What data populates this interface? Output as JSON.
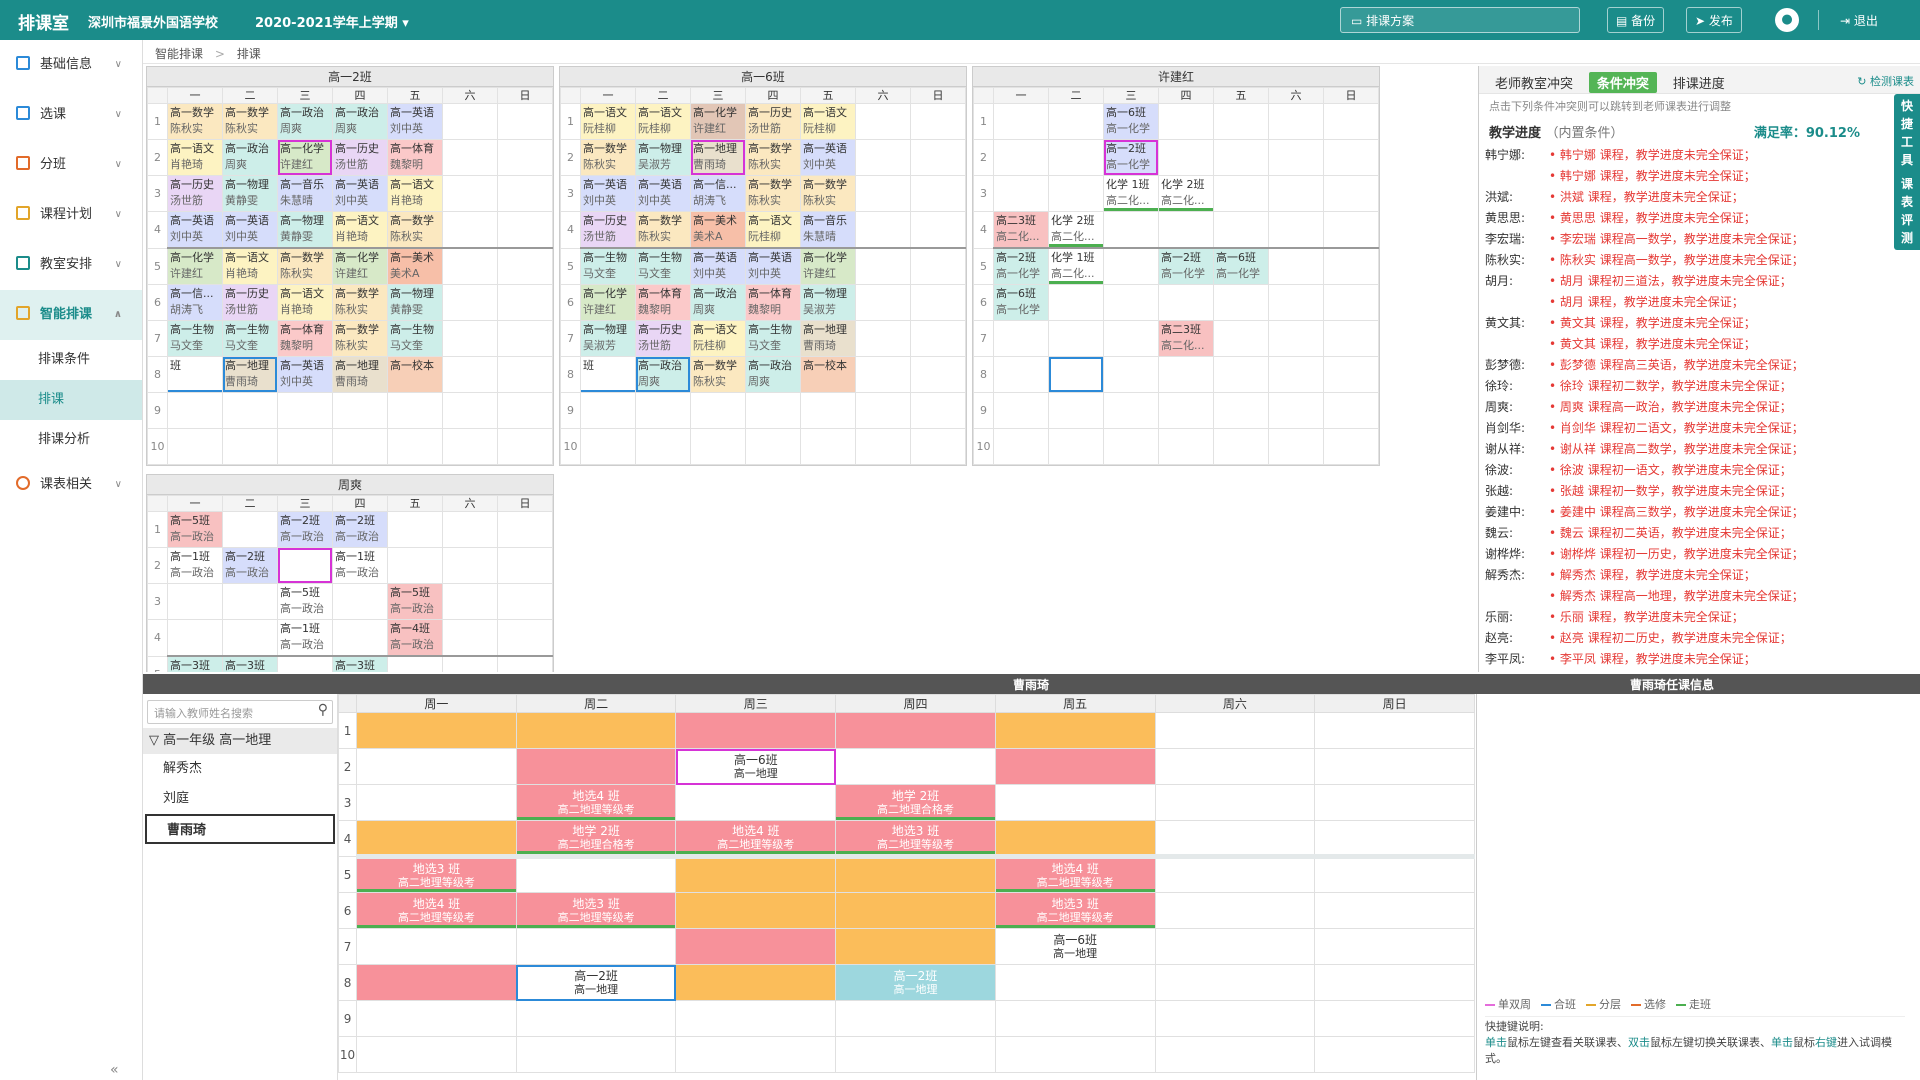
{
  "topbar": {
    "brand": "排课室",
    "school": "深圳市福景外国语学校",
    "term": "2020-2021学年上学期 ▾",
    "scheme": "排课方案",
    "backup": "备份",
    "publish": "发布",
    "logout": "退出"
  },
  "sidebar": {
    "items": [
      {
        "label": "基础信息",
        "icon": "info-icon",
        "color": "#2c8ad8"
      },
      {
        "label": "选课",
        "icon": "pencil-icon",
        "color": "#2c8ad8"
      },
      {
        "label": "分班",
        "icon": "branch-icon",
        "color": "#e26b2a"
      },
      {
        "label": "课程计划",
        "icon": "calendar-icon",
        "color": "#e2a52a"
      },
      {
        "label": "教室安排",
        "icon": "classroom-icon",
        "color": "#1b8c8a"
      },
      {
        "label": "智能排课",
        "icon": "smart-icon",
        "color": "#e2a52a"
      }
    ],
    "subitems": [
      "排课条件",
      "排课",
      "排课分析"
    ],
    "last": {
      "label": "课表相关",
      "icon": "search-icon",
      "color": "#e26b2a"
    }
  },
  "breadcrumb": {
    "root": "智能排课",
    "sep": ">",
    "current": "排课"
  },
  "weekdays_short": [
    "一",
    "二",
    "三",
    "四",
    "五",
    "六",
    "日"
  ],
  "weekdays_long": [
    "周一",
    "周二",
    "周三",
    "周四",
    "周五",
    "周六",
    "周日"
  ],
  "grids": [
    {
      "title": "高一2班",
      "rows": [
        [
          [
            "高一数学",
            "陈秋实",
            "#fbe8c0"
          ],
          [
            "高一数学",
            "陈秋实",
            "#fbe8c0"
          ],
          [
            "高一政治",
            "周爽",
            "#cdeee9"
          ],
          [
            "高一政治",
            "周爽",
            "#cdeee9"
          ],
          [
            "高一英语",
            "刘中英",
            "#d6ddfb"
          ],
          null,
          null
        ],
        [
          [
            "高一语文",
            "肖艳琦",
            "#fdf3c2"
          ],
          [
            "高一政治",
            "周爽",
            "#cdeee9"
          ],
          [
            "高一化学",
            "许建红",
            "#d7e9c8"
          ],
          [
            "高一历史",
            "汤世筋",
            "#e9d6f5"
          ],
          [
            "高一体育",
            "魏黎明",
            "#fbc9c9"
          ],
          null,
          null
        ],
        [
          [
            "高一历史",
            "汤世筋",
            "#e9d6f5"
          ],
          [
            "高一物理",
            "黄静雯",
            "#cdeee9"
          ],
          [
            "高一音乐",
            "朱慧晴",
            "#d6ddfb"
          ],
          [
            "高一英语",
            "刘中英",
            "#d6ddfb"
          ],
          [
            "高一语文",
            "肖艳琦",
            "#fdf3c2"
          ],
          null,
          null
        ],
        [
          [
            "高一英语",
            "刘中英",
            "#d6ddfb"
          ],
          [
            "高一英语",
            "刘中英",
            "#d6ddfb"
          ],
          [
            "高一物理",
            "黄静雯",
            "#cdeee9"
          ],
          [
            "高一语文",
            "肖艳琦",
            "#fdf3c2"
          ],
          [
            "高一数学",
            "陈秋实",
            "#fbe8c0"
          ],
          null,
          null
        ],
        [
          [
            "高一化学",
            "许建红",
            "#d7e9c8"
          ],
          [
            "高一语文",
            "肖艳琦",
            "#fdf3c2"
          ],
          [
            "高一数学",
            "陈秋实",
            "#fbe8c0"
          ],
          [
            "高一化学",
            "许建红",
            "#d7e9c8"
          ],
          [
            "高一美术",
            "美术A",
            "#f7bfa8"
          ],
          null,
          null
        ],
        [
          [
            "高一信...",
            "胡涛飞",
            "#d6ddfb"
          ],
          [
            "高一历史",
            "汤世筋",
            "#e9d6f5"
          ],
          [
            "高一语文",
            "肖艳琦",
            "#fdf3c2"
          ],
          [
            "高一数学",
            "陈秋实",
            "#fbe8c0"
          ],
          [
            "高一物理",
            "黄静雯",
            "#cdeee9"
          ],
          null,
          null
        ],
        [
          [
            "高一生物",
            "马文奎",
            "#cdeee9"
          ],
          [
            "高一生物",
            "马文奎",
            "#cdeee9"
          ],
          [
            "高一体育",
            "魏黎明",
            "#fbc9c9"
          ],
          [
            "高一数学",
            "陈秋实",
            "#fbe8c0"
          ],
          [
            "高一生物",
            "马文奎",
            "#cdeee9"
          ],
          null,
          null
        ],
        [
          [
            "班",
            "",
            "#ffffff"
          ],
          [
            "高一地理",
            "曹雨琦",
            "#e9e0cd"
          ],
          [
            "高一英语",
            "刘中英",
            "#d6ddfb"
          ],
          [
            "高一地理",
            "曹雨琦",
            "#e9e0cd"
          ],
          [
            "高一校本",
            "",
            "#f7cfb7"
          ],
          null,
          null
        ],
        [
          null,
          null,
          null,
          null,
          null,
          null,
          null
        ],
        [
          null,
          null,
          null,
          null,
          null,
          null,
          null
        ]
      ]
    },
    {
      "title": "高一6班",
      "rows": [
        [
          [
            "高一语文",
            "阮桂柳",
            "#fdf3c2"
          ],
          [
            "高一语文",
            "阮桂柳",
            "#fdf3c2"
          ],
          [
            "高一化学",
            "许建红",
            "#e2c6b6"
          ],
          [
            "高一历史",
            "汤世筋",
            "#fbe8c0"
          ],
          [
            "高一语文",
            "阮桂柳",
            "#fdf3c2"
          ],
          null,
          null
        ],
        [
          [
            "高一数学",
            "陈秋实",
            "#fbe8c0"
          ],
          [
            "高一物理",
            "吴淑芳",
            "#cdeee9"
          ],
          [
            "高一地理",
            "曹雨琦",
            "#e9e0cd"
          ],
          [
            "高一数学",
            "陈秋实",
            "#fbe8c0"
          ],
          [
            "高一英语",
            "刘中英",
            "#d6ddfb"
          ],
          null,
          null
        ],
        [
          [
            "高一英语",
            "刘中英",
            "#d6ddfb"
          ],
          [
            "高一英语",
            "刘中英",
            "#d6ddfb"
          ],
          [
            "高一信...",
            "胡涛飞",
            "#d6ddfb"
          ],
          [
            "高一数学",
            "陈秋实",
            "#fbe8c0"
          ],
          [
            "高一数学",
            "陈秋实",
            "#fbe8c0"
          ],
          null,
          null
        ],
        [
          [
            "高一历史",
            "汤世筋",
            "#e9d6f5"
          ],
          [
            "高一数学",
            "陈秋实",
            "#fbe8c0"
          ],
          [
            "高一美术",
            "美术A",
            "#f7bfa8"
          ],
          [
            "高一语文",
            "阮桂柳",
            "#fdf3c2"
          ],
          [
            "高一音乐",
            "朱慧晴",
            "#d6ddfb"
          ],
          null,
          null
        ],
        [
          [
            "高一生物",
            "马文奎",
            "#cdeee9"
          ],
          [
            "高一生物",
            "马文奎",
            "#cdeee9"
          ],
          [
            "高一英语",
            "刘中英",
            "#d6ddfb"
          ],
          [
            "高一英语",
            "刘中英",
            "#d6ddfb"
          ],
          [
            "高一化学",
            "许建红",
            "#d7e9c8"
          ],
          null,
          null
        ],
        [
          [
            "高一化学",
            "许建红",
            "#d7e9c8"
          ],
          [
            "高一体育",
            "魏黎明",
            "#fbc9c9"
          ],
          [
            "高一政治",
            "周爽",
            "#cdeee9"
          ],
          [
            "高一体育",
            "魏黎明",
            "#fbc9c9"
          ],
          [
            "高一物理",
            "吴淑芳",
            "#cdeee9"
          ],
          null,
          null
        ],
        [
          [
            "高一物理",
            "吴淑芳",
            "#cdeee9"
          ],
          [
            "高一历史",
            "汤世筋",
            "#e9d6f5"
          ],
          [
            "高一语文",
            "阮桂柳",
            "#fdf3c2"
          ],
          [
            "高一生物",
            "马文奎",
            "#cdeee9"
          ],
          [
            "高一地理",
            "曹雨琦",
            "#e9e0cd"
          ],
          null,
          null
        ],
        [
          [
            "班",
            "",
            "#ffffff"
          ],
          [
            "高一政治",
            "周爽",
            "#cdeee9"
          ],
          [
            "高一数学",
            "陈秋实",
            "#fbe8c0"
          ],
          [
            "高一政治",
            "周爽",
            "#cdeee9"
          ],
          [
            "高一校本",
            "",
            "#f7cfb7"
          ],
          null,
          null
        ],
        [
          null,
          null,
          null,
          null,
          null,
          null,
          null
        ],
        [
          null,
          null,
          null,
          null,
          null,
          null,
          null
        ]
      ]
    },
    {
      "title": "许建红",
      "rows": [
        [
          null,
          null,
          [
            "高一6班",
            "高一化学",
            "#d6ddfb"
          ],
          null,
          null,
          null,
          null
        ],
        [
          null,
          null,
          [
            "高一2班",
            "高一化学",
            "#d6ddfb"
          ],
          null,
          null,
          null,
          null
        ],
        [
          null,
          null,
          [
            "化学 1班",
            "高二化...",
            "#ffffff"
          ],
          [
            "化学 2班",
            "高二化...",
            "#ffffff"
          ],
          null,
          null,
          null
        ],
        [
          [
            "高二3班",
            "高二化...",
            "#f8c1c1"
          ],
          [
            "化学 2班",
            "高二化...",
            "#ffffff"
          ],
          null,
          null,
          null,
          null,
          null
        ],
        [
          [
            "高一2班",
            "高一化学",
            "#cdeee9"
          ],
          [
            "化学 1班",
            "高二化...",
            "#ffffff"
          ],
          null,
          [
            "高一2班",
            "高一化学",
            "#cdeee9"
          ],
          [
            "高一6班",
            "高一化学",
            "#cdeee9"
          ],
          null,
          null
        ],
        [
          [
            "高一6班",
            "高一化学",
            "#cdeee9"
          ],
          null,
          null,
          null,
          null,
          null,
          null
        ],
        [
          null,
          null,
          null,
          [
            "高二3班",
            "高二化...",
            "#f8c1c1"
          ],
          null,
          null,
          null
        ],
        [
          null,
          [
            "",
            "",
            "#ffffff"
          ],
          null,
          null,
          null,
          null,
          null
        ],
        [
          null,
          null,
          null,
          null,
          null,
          null,
          null
        ],
        [
          null,
          null,
          null,
          null,
          null,
          null,
          null
        ]
      ]
    },
    {
      "title": "周爽",
      "rows": [
        [
          [
            "高一5班",
            "高一政治",
            "#f8c1c1"
          ],
          null,
          [
            "高一2班",
            "高一政治",
            "#d6ddfb"
          ],
          [
            "高一2班",
            "高一政治",
            "#d6ddfb"
          ],
          null,
          null,
          null
        ],
        [
          [
            "高一1班",
            "高一政治",
            "#ffffff"
          ],
          [
            "高一2班",
            "高一政治",
            "#d6ddfb"
          ],
          [
            "",
            "",
            "#ffffff"
          ],
          [
            "高一1班",
            "高一政治",
            "#ffffff"
          ],
          null,
          null,
          null
        ],
        [
          null,
          null,
          [
            "高一5班",
            "高一政治",
            "#ffffff"
          ],
          null,
          [
            "高一5班",
            "高一政治",
            "#f8c1c1"
          ],
          null,
          null
        ],
        [
          null,
          null,
          [
            "高一1班",
            "高一政治",
            "#ffffff"
          ],
          null,
          [
            "高一4班",
            "高一政治",
            "#f8c1c1"
          ],
          null,
          null
        ],
        [
          [
            "高一3班",
            "",
            "#cdeee9"
          ],
          [
            "高一3班",
            "",
            "#cdeee9"
          ],
          null,
          [
            "高一3班",
            "",
            "#cdeee9"
          ],
          null,
          null,
          null
        ]
      ]
    }
  ],
  "right": {
    "tabs": [
      "老师教室冲突",
      "条件冲突",
      "排课进度"
    ],
    "detect": "检测课表",
    "hint": "点击下列条件冲突则可以跳转到老师课表进行调整",
    "progress_title": "教学进度",
    "progress_sub": "（内置条件）",
    "rate": "满足率：90.12%",
    "quick": [
      "快",
      "捷",
      "工",
      "具",
      "课",
      "表",
      "评",
      "测"
    ],
    "conflicts": [
      [
        "韩宁娜:",
        "• 韩宁娜 课程，教学进度未完全保证；"
      ],
      [
        "",
        "• 韩宁娜 课程，教学进度未完全保证；"
      ],
      [
        "洪斌:",
        "• 洪斌 课程，教学进度未完全保证；"
      ],
      [
        "黄思思:",
        "• 黄思思 课程，教学进度未完全保证；"
      ],
      [
        "李宏瑞:",
        "• 李宏瑞 课程高一数学，教学进度未完全保证；"
      ],
      [
        "陈秋实:",
        "• 陈秋实 课程高一数学，教学进度未完全保证；"
      ],
      [
        "胡月:",
        "• 胡月 课程初三道法，教学进度未完全保证；"
      ],
      [
        "",
        "• 胡月 课程，教学进度未完全保证；"
      ],
      [
        "黄文其:",
        "• 黄文其 课程，教学进度未完全保证；"
      ],
      [
        "",
        "• 黄文其 课程，教学进度未完全保证；"
      ],
      [
        "彭梦德:",
        "• 彭梦德 课程高三英语，教学进度未完全保证；"
      ],
      [
        "徐玲:",
        "• 徐玲 课程初二数学，教学进度未完全保证；"
      ],
      [
        "周爽:",
        "• 周爽 课程高一政治，教学进度未完全保证；"
      ],
      [
        "肖剑华:",
        "• 肖剑华 课程初二语文，教学进度未完全保证；"
      ],
      [
        "谢从祥:",
        "• 谢从祥 课程高二数学，教学进度未完全保证；"
      ],
      [
        "徐波:",
        "• 徐波 课程初一语文，教学进度未完全保证；"
      ],
      [
        "张越:",
        "• 张越 课程初一数学，教学进度未完全保证；"
      ],
      [
        "姜建中:",
        "• 姜建中 课程高三数学，教学进度未完全保证；"
      ],
      [
        "魏云:",
        "• 魏云 课程初二英语，教学进度未完全保证；"
      ],
      [
        "谢桦烨:",
        "• 谢桦烨 课程初一历史，教学进度未完全保证；"
      ],
      [
        "解秀杰:",
        "• 解秀杰 课程，教学进度未完全保证；"
      ],
      [
        "",
        "• 解秀杰 课程高一地理，教学进度未完全保证；"
      ],
      [
        "乐丽:",
        "• 乐丽 课程，教学进度未完全保证；"
      ],
      [
        "赵亮:",
        "• 赵亮 课程初二历史，教学进度未完全保证；"
      ],
      [
        "李平凤:",
        "• 李平凤 课程，教学进度未完全保证；"
      ]
    ]
  },
  "bottom": {
    "title": "曹雨琦",
    "info_title": "曹雨琦任课信息",
    "search_placeholder": "请输入教师姓名搜索",
    "filter": "高一年级 高一地理",
    "teachers": [
      "解秀杰",
      "刘庭",
      "曹雨琦"
    ],
    "rows": [
      [
        [
          "",
          "",
          "#fbbd5a"
        ],
        [
          "",
          "",
          "#fbbd5a"
        ],
        [
          "",
          "",
          "#f7919a"
        ],
        [
          "",
          "",
          "#f7919a"
        ],
        [
          "",
          "",
          "#fbbd5a"
        ],
        null,
        null
      ],
      [
        null,
        [
          "",
          "",
          "#f7919a"
        ],
        [
          "高一6班",
          "高一地理",
          "#ffffff"
        ],
        null,
        [
          "",
          "",
          "#f7919a"
        ],
        null,
        null
      ],
      [
        null,
        [
          "地选4 班",
          "高二地理等级考",
          "#f7919a"
        ],
        null,
        [
          "地学 2班",
          "高二地理合格考",
          "#f7919a"
        ],
        null,
        null,
        null
      ],
      [
        [
          "",
          "",
          "#fbbd5a"
        ],
        [
          "地学 2班",
          "高二地理合格考",
          "#f7919a"
        ],
        [
          "地选4 班",
          "高二地理等级考",
          "#f7919a"
        ],
        [
          "地选3 班",
          "高二地理等级考",
          "#f7919a"
        ],
        [
          "",
          "",
          "#fbbd5a"
        ],
        null,
        null
      ],
      [
        [
          "地选3 班",
          "高二地理等级考",
          "#f7919a"
        ],
        null,
        [
          "",
          "",
          "#fbbd5a"
        ],
        [
          "",
          "",
          "#fbbd5a"
        ],
        [
          "地选4 班",
          "高二地理等级考",
          "#f7919a"
        ],
        null,
        null
      ],
      [
        [
          "地选4 班",
          "高二地理等级考",
          "#f7919a"
        ],
        [
          "地选3 班",
          "高二地理等级考",
          "#f7919a"
        ],
        [
          "",
          "",
          "#fbbd5a"
        ],
        [
          "",
          "",
          "#fbbd5a"
        ],
        [
          "地选3 班",
          "高二地理等级考",
          "#f7919a"
        ],
        null,
        null
      ],
      [
        null,
        null,
        [
          "",
          "",
          "#f7919a"
        ],
        [
          "",
          "",
          "#fbbd5a"
        ],
        [
          "高一6班",
          "高一地理",
          "#ffffff"
        ],
        null,
        null
      ],
      [
        [
          "",
          "",
          "#f7919a"
        ],
        [
          "高一2班",
          "高一地理",
          "#ffffff"
        ],
        [
          "",
          "",
          "#fbbd5a"
        ],
        [
          "高一2班",
          "高一地理",
          "#9dd7de"
        ],
        null,
        null,
        null
      ],
      [
        null,
        null,
        null,
        null,
        null,
        null,
        null
      ],
      [
        null,
        null,
        null,
        null,
        null,
        null,
        null
      ]
    ],
    "legend": [
      "单双周",
      "合班",
      "分层",
      "选修",
      "走班"
    ],
    "legend_colors": [
      "#e46ddb",
      "#2c8ad8",
      "#e2a52a",
      "#e26b2a",
      "#4caf50"
    ],
    "shortcut_title": "快捷键说明:",
    "shortcut_parts": [
      "单击",
      "鼠标左键查看关联课表、",
      "双击",
      "鼠标左键切换关联课表、",
      "单击",
      "鼠标",
      "右键",
      "进入试调模式。"
    ]
  }
}
